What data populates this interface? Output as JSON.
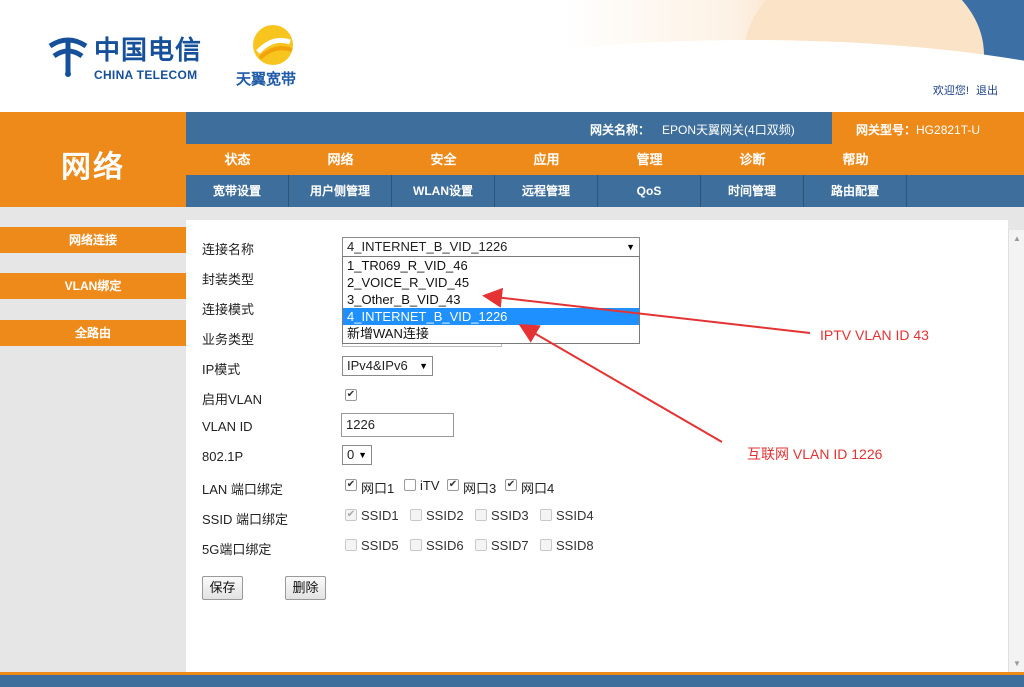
{
  "header": {
    "logo_cn": "中国电信",
    "logo_en": "CHINA TELECOM",
    "brand2": "天翼宽带",
    "welcome": "欢迎您!",
    "logout": "退出"
  },
  "section_title": "网络",
  "info_bar": {
    "gw_name_label": "网关名称：",
    "gw_name_value": "EPON天翼网关(4口双频)",
    "model_label": "网关型号：",
    "model_value": "HG2821T-U"
  },
  "main_nav": [
    "状态",
    "网络",
    "安全",
    "应用",
    "管理",
    "诊断",
    "帮助"
  ],
  "sub_nav": [
    "宽带设置",
    "用户侧管理",
    "WLAN设置",
    "远程管理",
    "QoS",
    "时间管理",
    "路由配置"
  ],
  "sidebar": [
    "网络连接",
    "VLAN绑定",
    "全路由"
  ],
  "form": {
    "conn_name_label": "连接名称",
    "conn_name_value": "4_INTERNET_B_VID_1226",
    "encap_label": "封装类型",
    "conn_mode_label": "连接模式",
    "service_label": "业务类型",
    "ip_mode_label": "IP模式",
    "ip_mode_value": "IPv4&IPv6",
    "vlan_enable_label": "启用VLAN",
    "vlan_id_label": "VLAN ID",
    "vlan_id_value": "1226",
    "dot1p_label": "802.1P",
    "dot1p_value": "0",
    "lan_bind_label": "LAN 端口绑定",
    "lan_ports": [
      {
        "label": "网口1",
        "checked": true
      },
      {
        "label": "iTV",
        "checked": false
      },
      {
        "label": "网口3",
        "checked": true
      },
      {
        "label": "网口4",
        "checked": true
      }
    ],
    "ssid_bind_label": "SSID 端口绑定",
    "ssid_ports": [
      {
        "label": "SSID1",
        "checked": true
      },
      {
        "label": "SSID2",
        "checked": false
      },
      {
        "label": "SSID3",
        "checked": false
      },
      {
        "label": "SSID4",
        "checked": false
      }
    ],
    "ssid5g_bind_label": "5G端口绑定",
    "ssid5g_ports": [
      {
        "label": "SSID5",
        "checked": false
      },
      {
        "label": "SSID6",
        "checked": false
      },
      {
        "label": "SSID7",
        "checked": false
      },
      {
        "label": "SSID8",
        "checked": false
      }
    ],
    "save_label": "保存",
    "delete_label": "删除"
  },
  "dropdown_options": [
    "1_TR069_R_VID_46",
    "2_VOICE_R_VID_45",
    "3_Other_B_VID_43",
    "4_INTERNET_B_VID_1226",
    "新增WAN连接"
  ],
  "dropdown_selected_index": 3,
  "annotations": {
    "iptv": "IPTV VLAN ID 43",
    "internet": "互联网 VLAN ID 1226"
  },
  "colors": {
    "orange": "#ee8a1a",
    "blue": "#3e6e9b",
    "annotation_red": "#e53333",
    "highlight": "#1e90ff"
  }
}
